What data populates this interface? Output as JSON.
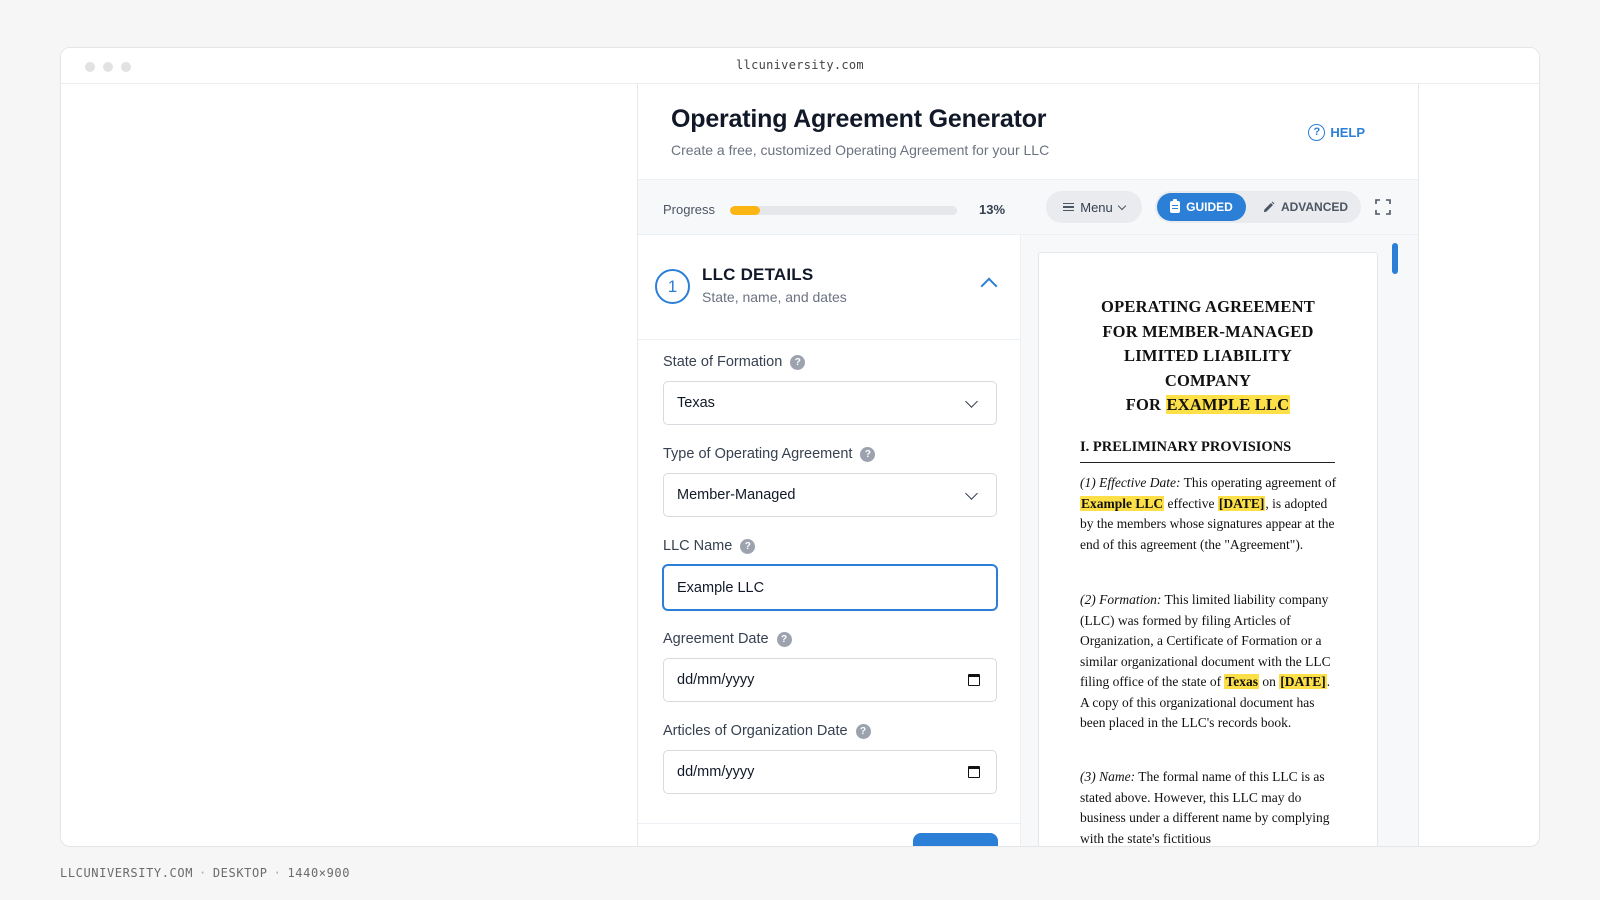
{
  "browser": {
    "url": "llcuniversity.com"
  },
  "header": {
    "title": "Operating Agreement Generator",
    "subtitle": "Create a free, customized Operating Agreement for your LLC",
    "help_label": "HELP"
  },
  "toolbar": {
    "progress_label": "Progress",
    "progress_value": 0.13,
    "progress_text": "13%",
    "menu_label": "Menu",
    "mode_guided": "GUIDED",
    "mode_advanced": "ADVANCED",
    "active_mode": "guided"
  },
  "section": {
    "number": "1",
    "title": "LLC DETAILS",
    "subtitle": "State, name, and dates"
  },
  "fields": {
    "state": {
      "label": "State of Formation",
      "value": "Texas"
    },
    "type": {
      "label": "Type of Operating Agreement",
      "value": "Member-Managed"
    },
    "name": {
      "label": "LLC Name",
      "value": "Example LLC"
    },
    "agreement_date": {
      "label": "Agreement Date",
      "value": "dd/mm/yyyy"
    },
    "articles_date": {
      "label": "Articles of Organization Date",
      "value": "dd/mm/yyyy"
    }
  },
  "document": {
    "title_lines": [
      "OPERATING AGREEMENT",
      "FOR MEMBER-MANAGED",
      "LIMITED LIABILITY",
      "COMPANY"
    ],
    "title_for": "FOR",
    "title_company": "EXAMPLE LLC",
    "heading": "I. PRELIMINARY PROVISIONS",
    "p1": {
      "label": "(1) Effective Date:",
      "t1": " This operating agreement of ",
      "h1": "Example LLC",
      "t2": " effective ",
      "h2": "[DATE]",
      "t3": ", is adopted by the members whose signatures appear at the end of this agreement (the \"Agreement\")."
    },
    "p2": {
      "label": "(2) Formation:",
      "t1": " This limited liability company (LLC) was formed by filing Articles of Organization, a Certificate of Formation or a similar organizational document with the LLC filing office of the state of ",
      "h1": "Texas",
      "t2": " on ",
      "h2": "[DATE]",
      "t3": ". A copy of this organizational document has been placed in the LLC's records book."
    },
    "p3": {
      "label": "(3) Name:",
      "t1": " The formal name of this LLC is as stated above. However, this LLC may do business under a different name by complying with the state's fictitious"
    }
  },
  "caption": {
    "site": "LLCUNIVERSITY.COM",
    "device": "DESKTOP",
    "size": "1440×900"
  },
  "colors": {
    "accent": "#2b7fd6",
    "progress": "#fbb614",
    "highlight": "#fde047"
  }
}
